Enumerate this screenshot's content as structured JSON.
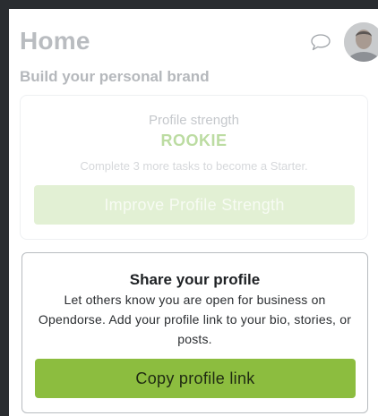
{
  "header": {
    "title": "Home",
    "chat_icon": "chat-bubble-icon",
    "avatar": "user-avatar"
  },
  "brand_section": {
    "heading": "Build your personal brand"
  },
  "profile_strength": {
    "label": "Profile strength",
    "level": "ROOKIE",
    "hint": "Complete 3 more tasks to become a Starter.",
    "button_label": "Improve Profile Strength"
  },
  "share_profile": {
    "title": "Share your profile",
    "description": "Let others know you are open for business on Opendorse. Add your profile link to your bio, stories, or posts.",
    "button_label": "Copy profile link"
  },
  "colors": {
    "accent": "#8cbd3f",
    "accent_faded": "#e2f0d4",
    "level_text": "#bcdca2",
    "frame": "#2a2d31"
  }
}
